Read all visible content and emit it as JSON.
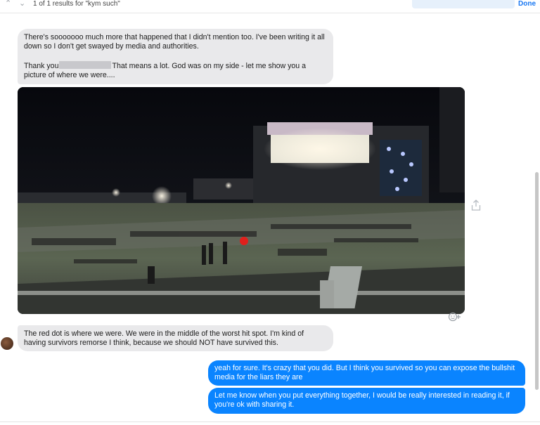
{
  "search": {
    "results_text": "1 of 1 results for \"kym such\"",
    "done_label": "Done"
  },
  "messages": {
    "incoming_1_line1": "There's sooooooo much more that happened that I didn't mention too. I've been writing it all down so I don't get swayed by media and authorities.",
    "incoming_1_pre": "Thank you",
    "incoming_1_post": "That means a lot. God was on my side - let me show you a picture of where we were....",
    "incoming_2": "The red dot is where we were. We were in the middle of the worst hit spot. I'm kind of having survivors remorse I think, because we should NOT have survived this.",
    "outgoing_1": "yeah for sure. It's crazy that you did. But I think you survived so you can expose the bullshit media for the liars they are",
    "outgoing_2": "Let me know when you put everything together, I would be really interested in reading it, if you're ok with sharing it."
  },
  "icons": {
    "up": "chevron-up-icon",
    "down": "chevron-down-icon",
    "share": "share-icon",
    "reaction": "add-reaction-icon"
  },
  "colors": {
    "incoming_bubble": "#e9e9eb",
    "outgoing_bubble": "#0a84ff",
    "accent": "#1877f2",
    "red_dot": "#e0201c"
  }
}
